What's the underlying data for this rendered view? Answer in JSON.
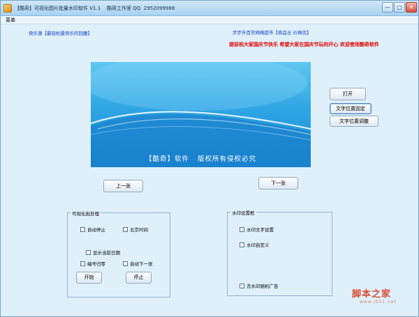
{
  "window": {
    "title": "【酷奇】可视化图片批量水印软件 V1.1    酷奇工作室 QQ  2952099988",
    "minimize": "—",
    "maximize": "□",
    "close": "✕"
  },
  "menu": {
    "item": "菜单"
  },
  "top": {
    "left_link": "快乐源【最轻松最快乐的回腰】",
    "right_link": "步步升百货网络超市【商品全 价格优】",
    "red_banner": "提前祝大家国庆节快乐  希望大家在国庆节玩的开心  欢迎使用酷奇软件"
  },
  "banner": {
    "caption": "【酷奇】软件   版权所有侵权必究"
  },
  "side_buttons": {
    "open": "打开",
    "fix_text_pos": "文字位置固定",
    "adjust_text_pos": "文字位置调整"
  },
  "nav": {
    "prev": "上一张",
    "next": "下一张"
  },
  "batch_group": {
    "title": "可视化批处理",
    "auto_stop": "自动停止",
    "beijing_time": "北京时间",
    "show_date": "显示当前日期",
    "number_reset": "编号归零",
    "auto_next": "自动下一张",
    "start": "开始",
    "stop": "停止"
  },
  "watermark_group": {
    "title": "水印设置框",
    "text_setting": "水印文字设置",
    "custom": "水印自定义",
    "random_ad": "去水印随机广告"
  },
  "site_watermark": {
    "name": "脚本之家",
    "url": "www.jb51.net"
  }
}
